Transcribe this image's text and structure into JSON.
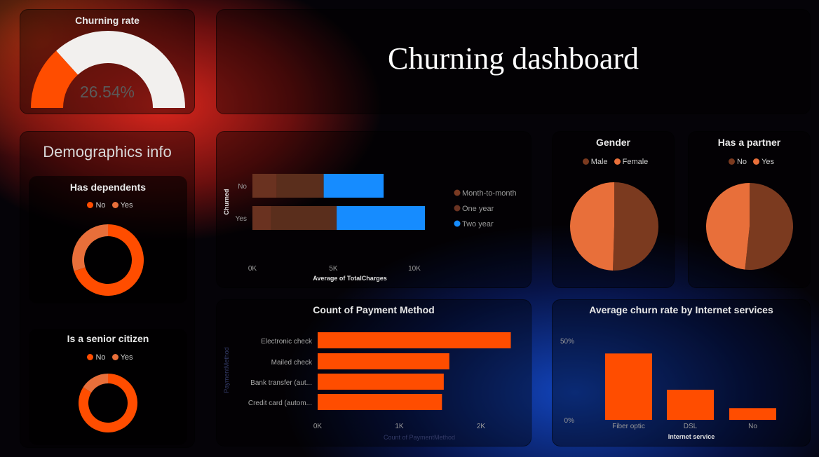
{
  "colors": {
    "accent": "#ff4d00",
    "light_orange": "#e86f3a",
    "dark_brown": "#7b3a1f",
    "brown": "#5a2b1c",
    "blue": "#168cff",
    "gauge_track": "#f2f0ee"
  },
  "gauge": {
    "title": "Churning rate",
    "value_label": "26.54%",
    "value": 0.2654
  },
  "header": {
    "title": "Churning dashboard"
  },
  "demographics": {
    "heading": "Demographics info",
    "dependents": {
      "title": "Has dependents",
      "legend": [
        {
          "label": "No",
          "color": "#ff4d00"
        },
        {
          "label": "Yes",
          "color": "#e86f3a"
        }
      ],
      "values": {
        "No": 70,
        "Yes": 30
      }
    },
    "senior": {
      "title": "Is a senior citizen",
      "legend": [
        {
          "label": "No",
          "color": "#ff4d00"
        },
        {
          "label": "Yes",
          "color": "#e86f3a"
        }
      ],
      "values": {
        "No": 84,
        "Yes": 16
      }
    }
  },
  "chart_data": [
    {
      "type": "bar",
      "orientation": "horizontal-stacked",
      "categories": [
        "No",
        "Yes"
      ],
      "series": [
        {
          "name": "Month-to-month",
          "values": [
            1500,
            1150
          ]
        },
        {
          "name": "One year",
          "values": [
            2900,
            4050
          ]
        },
        {
          "name": "Two year",
          "values": [
            3700,
            5450
          ]
        }
      ],
      "xlabel": "Average of TotalCharges",
      "ylabel": "Churned",
      "xticks": [
        "0K",
        "5K",
        "10K"
      ],
      "xlim": [
        0,
        10000
      ],
      "legend": "right"
    },
    {
      "type": "pie",
      "title": "Gender",
      "labels": [
        "Male",
        "Female"
      ],
      "values": [
        50.5,
        49.5
      ],
      "legend": "top"
    },
    {
      "type": "pie",
      "title": "Has a partner",
      "labels": [
        "No",
        "Yes"
      ],
      "values": [
        51.7,
        48.3
      ],
      "legend": "top"
    },
    {
      "type": "bar",
      "orientation": "horizontal",
      "title": "Count of Payment Method",
      "categories": [
        "Electronic check",
        "Mailed check",
        "Bank transfer (aut...",
        "Credit card (autom..."
      ],
      "values": [
        2365,
        1612,
        1544,
        1522
      ],
      "xlabel": "Count of PaymentMethod",
      "ylabel": "PaymentMethod",
      "xticks": [
        "0K",
        "1K",
        "2K"
      ],
      "xlim": [
        0,
        2000
      ]
    },
    {
      "type": "bar",
      "title": "Average churn rate by Internet services",
      "categories": [
        "Fiber optic",
        "DSL",
        "No"
      ],
      "values": [
        41.9,
        19.0,
        7.4
      ],
      "xlabel": "Internet service",
      "yticks": [
        "50%",
        "0%"
      ],
      "ylim": [
        0,
        50
      ]
    }
  ]
}
